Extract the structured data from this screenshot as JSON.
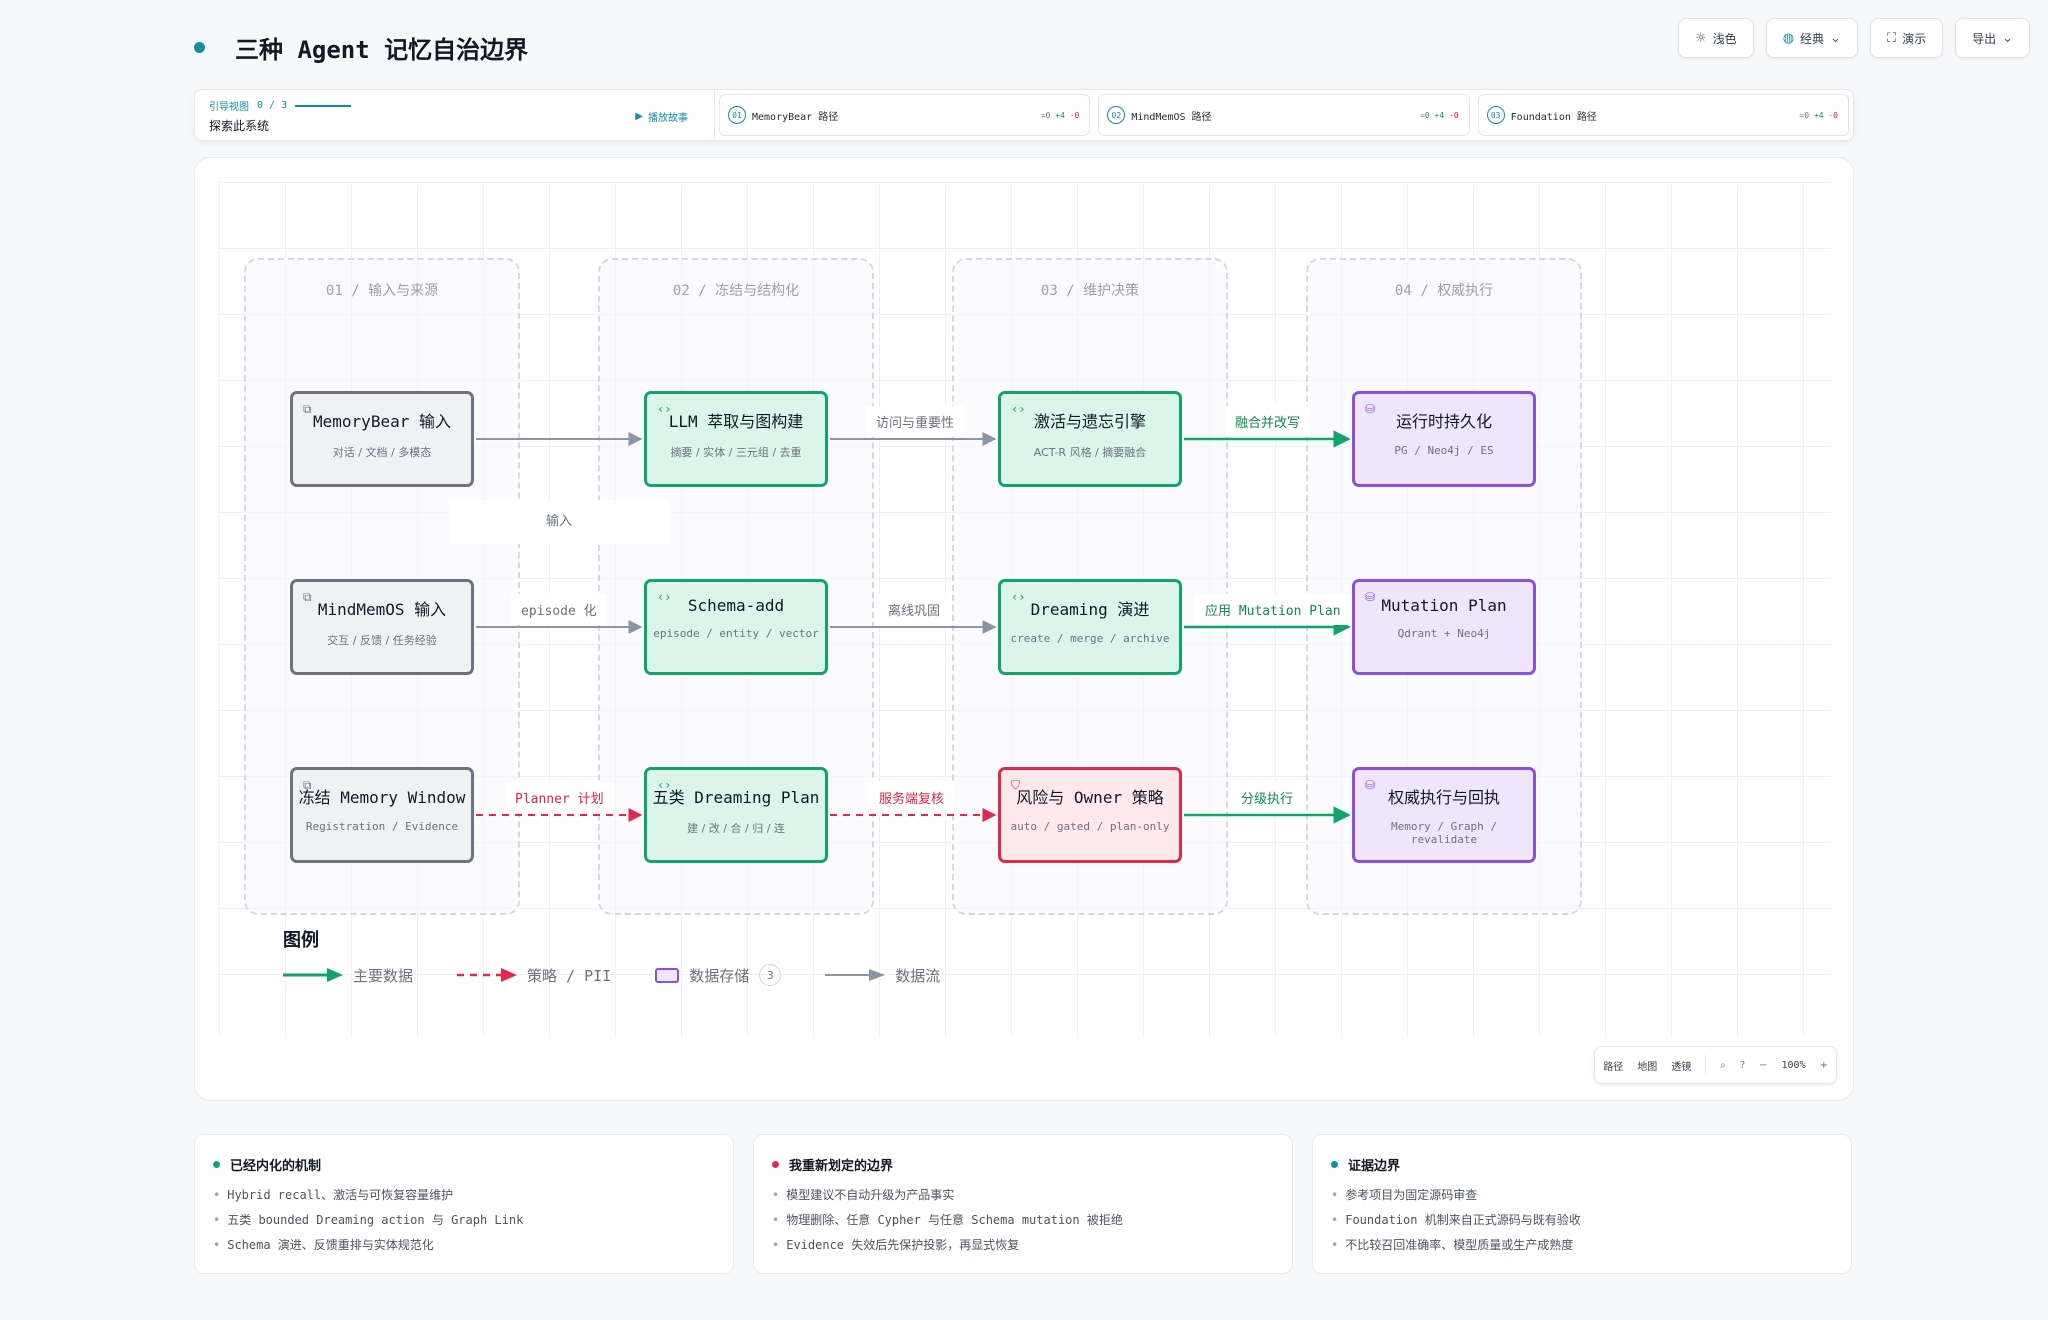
{
  "header": {
    "title": "三种 Agent 记忆自治边界"
  },
  "toolbar": {
    "theme_label": "浅色",
    "theme_icon": "sun-icon",
    "style_label": "经典",
    "style_icon": "palette-icon",
    "present_label": "演示",
    "present_icon": "expand-icon",
    "export_label": "导出"
  },
  "guide": {
    "tag": "引导视图",
    "progress": "0 / 3",
    "subtitle": "探索此系统",
    "play_label": "播放故事",
    "paths": [
      {
        "num": "01",
        "label": "MemoryBear 路径",
        "eq": "=0",
        "plus": "+4",
        "minus": "-0"
      },
      {
        "num": "02",
        "label": "MindMemOS 路径",
        "eq": "=0",
        "plus": "+4",
        "minus": "-0"
      },
      {
        "num": "03",
        "label": "Foundation 路径",
        "eq": "=0",
        "plus": "+4",
        "minus": "-0"
      }
    ]
  },
  "lanes": [
    {
      "title": "01 / 输入与来源"
    },
    {
      "title": "02 / 冻结与结构化"
    },
    {
      "title": "03 / 维护决策"
    },
    {
      "title": "04 / 权威执行"
    }
  ],
  "nodes": {
    "memorybear_input": {
      "title": "MemoryBear 输入",
      "sub": "对话 / 文档 / 多模态"
    },
    "mindmemos_input": {
      "title": "MindMemOS 输入",
      "sub": "交互 / 反馈 / 任务经验"
    },
    "freeze_window": {
      "title": "冻结 Memory Window",
      "sub": "Registration / Evidence"
    },
    "llm_extract": {
      "title": "LLM 萃取与图构建",
      "sub": "摘要 / 实体 / 三元组 / 去重"
    },
    "schema_add": {
      "title": "Schema-add",
      "sub": "episode / entity / vector"
    },
    "dreaming_plan": {
      "title": "五类 Dreaming Plan",
      "sub": "建 / 改 / 合 / 归 / 连"
    },
    "activation": {
      "title": "激活与遗忘引擎",
      "sub": "ACT-R 风格 / 摘要融合"
    },
    "dreaming_evolve": {
      "title": "Dreaming 演进",
      "sub": "create / merge / archive"
    },
    "risk_owner": {
      "title": "风险与 Owner 策略",
      "sub": "auto / gated / plan-only"
    },
    "runtime_persist": {
      "title": "运行时持久化",
      "sub": "PG / Neo4j / ES"
    },
    "mutation_plan": {
      "title": "Mutation Plan",
      "sub": "Qdrant + Neo4j"
    },
    "authority_exec": {
      "title": "权威执行与回执",
      "sub": "Memory / Graph / revalidate"
    }
  },
  "edge_labels": {
    "input": "输入",
    "access": "访问与重要性",
    "merge_write": "融合并改写",
    "episode": "episode 化",
    "offline": "离线巩固",
    "apply_plan": "应用 Mutation Plan",
    "planner": "Planner 计划",
    "server_review": "服务端复核",
    "tiered_exec": "分级执行"
  },
  "legend": {
    "title": "图例",
    "main_data": "主要数据",
    "policy": "策略 / PII",
    "storage": "数据存储",
    "storage_count": "3",
    "flow": "数据流"
  },
  "zoombar": {
    "path": "路径",
    "map": "地图",
    "lens": "透镜",
    "zoom": "100%"
  },
  "cards": [
    {
      "title": "已经内化的机制",
      "dot": "#10a36b",
      "items": [
        "Hybrid recall、激活与可恢复容量维护",
        "五类 bounded Dreaming action 与 Graph Link",
        "Schema 演进、反馈重排与实体规范化"
      ]
    },
    {
      "title": "我重新划定的边界",
      "dot": "#e0294d",
      "items": [
        "模型建议不自动升级为产品事实",
        "物理删除、任意 Cypher 与任意 Schema mutation 被拒绝",
        "Evidence 失效后先保护投影，再显式恢复"
      ]
    },
    {
      "title": "证据边界",
      "dot": "#0e8fa6",
      "items": [
        "参考项目为固定源码审查",
        "Foundation 机制来自正式源码与既有验收",
        "不比较召回准确率、模型质量或生产成熟度"
      ]
    }
  ],
  "colors": {
    "accent": "#0e8fa6",
    "green": "#10a36b",
    "red": "#e0294d",
    "purple": "#8b4fe0",
    "gray": "#6b7280"
  }
}
